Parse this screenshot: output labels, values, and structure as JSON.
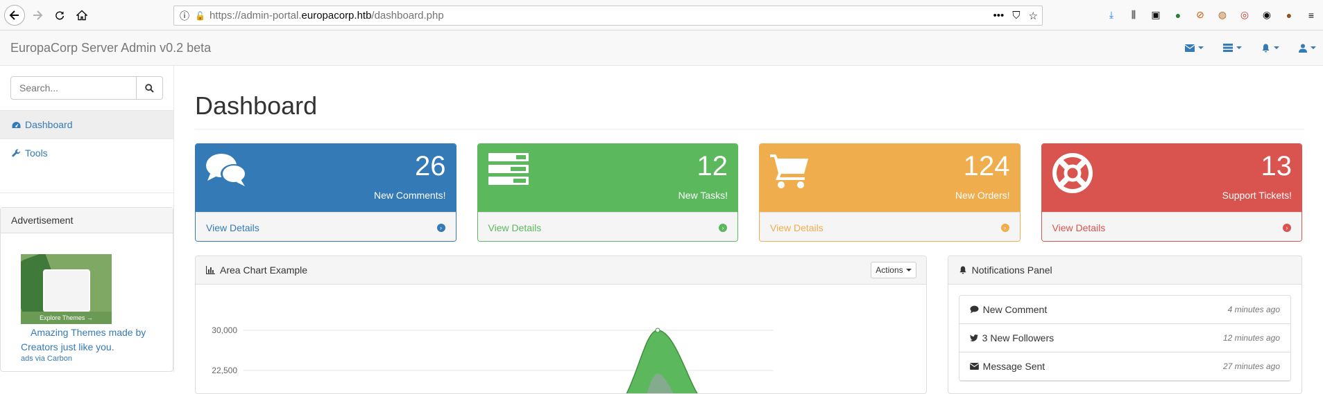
{
  "browser": {
    "url_prefix": "https://admin-portal.",
    "url_host": "europacorp.htb",
    "url_path": "/dashboard.php"
  },
  "navbar": {
    "brand": "EuropaCorp Server Admin v0.2 beta"
  },
  "sidebar": {
    "search_placeholder": "Search...",
    "items": [
      {
        "label": "Dashboard",
        "icon": "dashboard-icon"
      },
      {
        "label": "Tools",
        "icon": "wrench-icon"
      }
    ],
    "ad": {
      "heading": "Advertisement",
      "image_caption": "Explore Themes →",
      "link_text": "Amazing Themes made by Creators just like you.",
      "via_text": "ads via Carbon"
    }
  },
  "main": {
    "title": "Dashboard",
    "cards": [
      {
        "count": "26",
        "label": "New Comments!",
        "footer": "View Details",
        "color": "#337ab7",
        "icon": "comments-icon"
      },
      {
        "count": "12",
        "label": "New Tasks!",
        "footer": "View Details",
        "color": "#5cb85c",
        "icon": "tasks-icon"
      },
      {
        "count": "124",
        "label": "New Orders!",
        "footer": "View Details",
        "color": "#f0ad4e",
        "icon": "cart-icon"
      },
      {
        "count": "13",
        "label": "Support Tickets!",
        "footer": "View Details",
        "color": "#d9534f",
        "icon": "life-ring-icon"
      }
    ],
    "chart_panel": {
      "title": "Area Chart Example",
      "actions_label": "Actions"
    },
    "notifications": {
      "title": "Notifications Panel",
      "items": [
        {
          "label": "New Comment",
          "time": "4 minutes ago",
          "icon": "comment-icon"
        },
        {
          "label": "3 New Followers",
          "time": "12 minutes ago",
          "icon": "twitter-icon"
        },
        {
          "label": "Message Sent",
          "time": "27 minutes ago",
          "icon": "envelope-icon"
        }
      ]
    }
  },
  "chart_data": {
    "type": "area",
    "title": "",
    "y_ticks": [
      "30,000",
      "22,500"
    ],
    "visible_y_range": [
      22500,
      30000
    ],
    "series": [
      {
        "color": "#5cb85c",
        "peak_value": 30000
      }
    ]
  }
}
